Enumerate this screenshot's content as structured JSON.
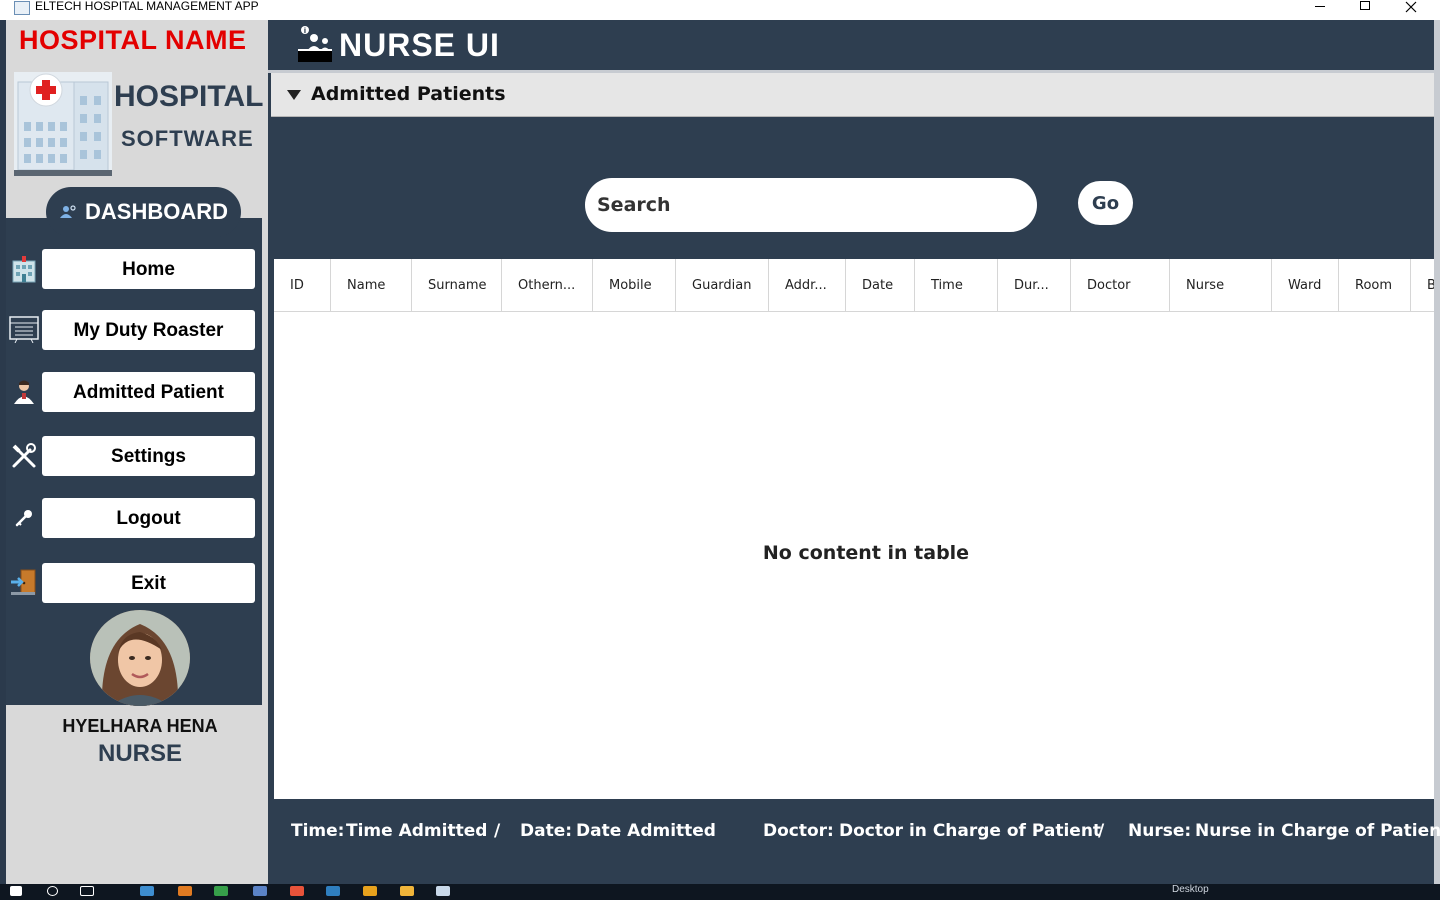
{
  "window": {
    "title": "ELTECH HOSPITAL MANAGEMENT APP",
    "controls": [
      "minimize-icon",
      "maximize-icon",
      "close-icon"
    ]
  },
  "sidebar": {
    "hospital_name": "HOSPITAL NAME",
    "brand_line1": "HOSPITAL",
    "brand_line2": "SOFTWARE",
    "dashboard_label": "DASHBOARD",
    "nav": [
      {
        "label": "Home",
        "icon": "hospital-building-icon"
      },
      {
        "label": "My Duty Roaster",
        "icon": "calendar-board-icon"
      },
      {
        "label": "Admitted Patient",
        "icon": "patient-icon"
      },
      {
        "label": "Settings",
        "icon": "tools-icon"
      },
      {
        "label": "Logout",
        "icon": "key-icon"
      },
      {
        "label": "Exit",
        "icon": "door-exit-icon"
      }
    ],
    "user": {
      "name": "HYELHARA HENA",
      "role": "NURSE"
    }
  },
  "header": {
    "title": "NURSE UI"
  },
  "section": {
    "title": "Admitted Patients",
    "search_placeholder": "Search",
    "go_label": "Go"
  },
  "table": {
    "columns": [
      "ID",
      "Name",
      "Surname",
      "Othern...",
      "Mobile",
      "Guardian",
      "Addr...",
      "Date",
      "Time",
      "Dur...",
      "Doctor",
      "Nurse",
      "Ward",
      "Room",
      "B"
    ],
    "empty_message": "No content in table"
  },
  "footer": {
    "time_label": "Time:",
    "time_value": "Time Admitted",
    "separator": "/",
    "date_label": "Date:",
    "date_value": "Date Admitted",
    "doctor_label": "Doctor:",
    "doctor_value": "Doctor in Charge of Patient",
    "nurse_label": "Nurse:",
    "nurse_value": "Nurse in Charge of Patient"
  },
  "taskbar": {
    "desktop_label": "Desktop"
  },
  "colors": {
    "primary": "#2e3e50",
    "hospital_name": "#e30000",
    "sidebar_bg": "#d9d9d9"
  }
}
